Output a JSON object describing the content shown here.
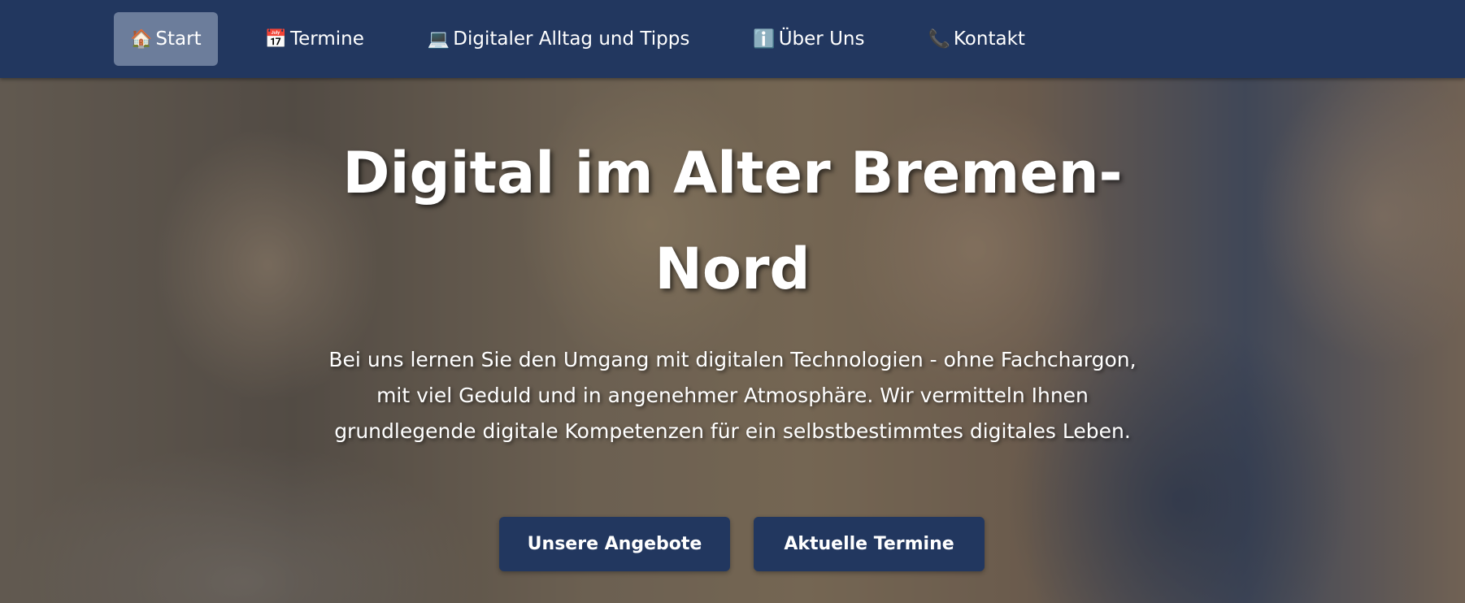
{
  "nav": {
    "items": [
      {
        "icon": "🏠",
        "icon_name": "house-icon",
        "label": "Start",
        "active": true
      },
      {
        "icon": "📅",
        "icon_name": "calendar-icon",
        "label": "Termine",
        "active": false
      },
      {
        "icon": "💻",
        "icon_name": "laptop-icon",
        "label": "Digitaler Alltag und Tipps",
        "active": false
      },
      {
        "icon": "ℹ️",
        "icon_name": "info-icon",
        "label": "Über Uns",
        "active": false
      },
      {
        "icon": "📞",
        "icon_name": "phone-icon",
        "label": "Kontakt",
        "active": false
      }
    ]
  },
  "hero": {
    "title": "Digital im Alter Bremen-Nord",
    "text": "Bei uns lernen Sie den Umgang mit digitalen Technologien - ohne Fachchargon, mit viel Geduld und in angenehmer Atmosphäre. Wir vermitteln Ihnen grundlegende digitale Kompetenzen für ein selbstbestimmtes digitales Leben.",
    "buttons": {
      "offers_label": "Unsere Angebote",
      "dates_label": "Aktuelle Termine"
    }
  },
  "colors": {
    "navbar_bg": "#22375f",
    "nav_active_bg": "#6c7d9b",
    "button_bg": "#22375f",
    "text": "#ffffff"
  }
}
